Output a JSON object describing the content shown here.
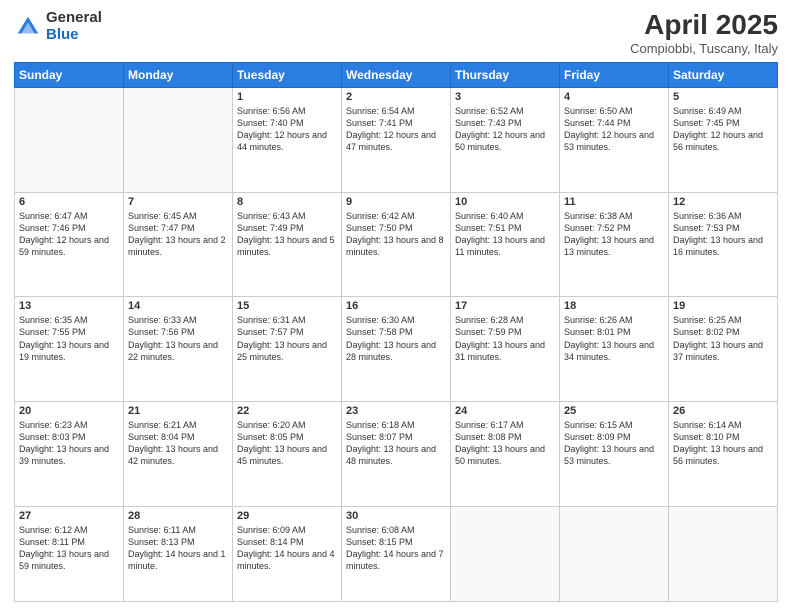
{
  "header": {
    "logo_general": "General",
    "logo_blue": "Blue",
    "month_title": "April 2025",
    "location": "Compiobbi, Tuscany, Italy"
  },
  "weekdays": [
    "Sunday",
    "Monday",
    "Tuesday",
    "Wednesday",
    "Thursday",
    "Friday",
    "Saturday"
  ],
  "weeks": [
    [
      {
        "day": "",
        "info": ""
      },
      {
        "day": "",
        "info": ""
      },
      {
        "day": "1",
        "info": "Sunrise: 6:56 AM\nSunset: 7:40 PM\nDaylight: 12 hours and 44 minutes."
      },
      {
        "day": "2",
        "info": "Sunrise: 6:54 AM\nSunset: 7:41 PM\nDaylight: 12 hours and 47 minutes."
      },
      {
        "day": "3",
        "info": "Sunrise: 6:52 AM\nSunset: 7:43 PM\nDaylight: 12 hours and 50 minutes."
      },
      {
        "day": "4",
        "info": "Sunrise: 6:50 AM\nSunset: 7:44 PM\nDaylight: 12 hours and 53 minutes."
      },
      {
        "day": "5",
        "info": "Sunrise: 6:49 AM\nSunset: 7:45 PM\nDaylight: 12 hours and 56 minutes."
      }
    ],
    [
      {
        "day": "6",
        "info": "Sunrise: 6:47 AM\nSunset: 7:46 PM\nDaylight: 12 hours and 59 minutes."
      },
      {
        "day": "7",
        "info": "Sunrise: 6:45 AM\nSunset: 7:47 PM\nDaylight: 13 hours and 2 minutes."
      },
      {
        "day": "8",
        "info": "Sunrise: 6:43 AM\nSunset: 7:49 PM\nDaylight: 13 hours and 5 minutes."
      },
      {
        "day": "9",
        "info": "Sunrise: 6:42 AM\nSunset: 7:50 PM\nDaylight: 13 hours and 8 minutes."
      },
      {
        "day": "10",
        "info": "Sunrise: 6:40 AM\nSunset: 7:51 PM\nDaylight: 13 hours and 11 minutes."
      },
      {
        "day": "11",
        "info": "Sunrise: 6:38 AM\nSunset: 7:52 PM\nDaylight: 13 hours and 13 minutes."
      },
      {
        "day": "12",
        "info": "Sunrise: 6:36 AM\nSunset: 7:53 PM\nDaylight: 13 hours and 16 minutes."
      }
    ],
    [
      {
        "day": "13",
        "info": "Sunrise: 6:35 AM\nSunset: 7:55 PM\nDaylight: 13 hours and 19 minutes."
      },
      {
        "day": "14",
        "info": "Sunrise: 6:33 AM\nSunset: 7:56 PM\nDaylight: 13 hours and 22 minutes."
      },
      {
        "day": "15",
        "info": "Sunrise: 6:31 AM\nSunset: 7:57 PM\nDaylight: 13 hours and 25 minutes."
      },
      {
        "day": "16",
        "info": "Sunrise: 6:30 AM\nSunset: 7:58 PM\nDaylight: 13 hours and 28 minutes."
      },
      {
        "day": "17",
        "info": "Sunrise: 6:28 AM\nSunset: 7:59 PM\nDaylight: 13 hours and 31 minutes."
      },
      {
        "day": "18",
        "info": "Sunrise: 6:26 AM\nSunset: 8:01 PM\nDaylight: 13 hours and 34 minutes."
      },
      {
        "day": "19",
        "info": "Sunrise: 6:25 AM\nSunset: 8:02 PM\nDaylight: 13 hours and 37 minutes."
      }
    ],
    [
      {
        "day": "20",
        "info": "Sunrise: 6:23 AM\nSunset: 8:03 PM\nDaylight: 13 hours and 39 minutes."
      },
      {
        "day": "21",
        "info": "Sunrise: 6:21 AM\nSunset: 8:04 PM\nDaylight: 13 hours and 42 minutes."
      },
      {
        "day": "22",
        "info": "Sunrise: 6:20 AM\nSunset: 8:05 PM\nDaylight: 13 hours and 45 minutes."
      },
      {
        "day": "23",
        "info": "Sunrise: 6:18 AM\nSunset: 8:07 PM\nDaylight: 13 hours and 48 minutes."
      },
      {
        "day": "24",
        "info": "Sunrise: 6:17 AM\nSunset: 8:08 PM\nDaylight: 13 hours and 50 minutes."
      },
      {
        "day": "25",
        "info": "Sunrise: 6:15 AM\nSunset: 8:09 PM\nDaylight: 13 hours and 53 minutes."
      },
      {
        "day": "26",
        "info": "Sunrise: 6:14 AM\nSunset: 8:10 PM\nDaylight: 13 hours and 56 minutes."
      }
    ],
    [
      {
        "day": "27",
        "info": "Sunrise: 6:12 AM\nSunset: 8:11 PM\nDaylight: 13 hours and 59 minutes."
      },
      {
        "day": "28",
        "info": "Sunrise: 6:11 AM\nSunset: 8:13 PM\nDaylight: 14 hours and 1 minute."
      },
      {
        "day": "29",
        "info": "Sunrise: 6:09 AM\nSunset: 8:14 PM\nDaylight: 14 hours and 4 minutes."
      },
      {
        "day": "30",
        "info": "Sunrise: 6:08 AM\nSunset: 8:15 PM\nDaylight: 14 hours and 7 minutes."
      },
      {
        "day": "",
        "info": ""
      },
      {
        "day": "",
        "info": ""
      },
      {
        "day": "",
        "info": ""
      }
    ]
  ]
}
